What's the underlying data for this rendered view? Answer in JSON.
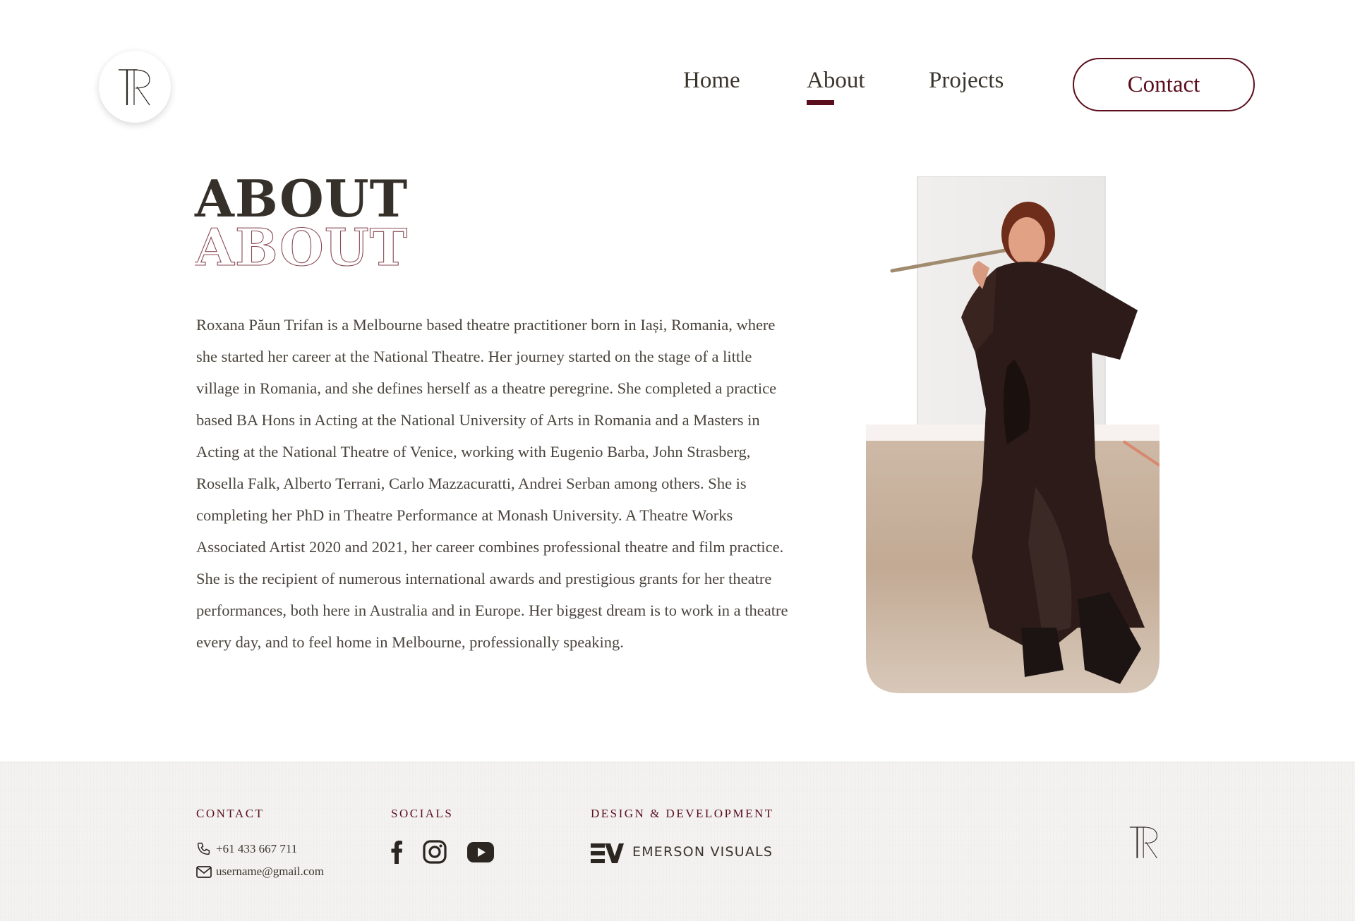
{
  "header": {
    "logo_alt": "TR monogram logo",
    "nav": [
      {
        "label": "Home"
      },
      {
        "label": "About"
      },
      {
        "label": "Projects"
      }
    ],
    "active_nav": "About",
    "contact_button": "Contact"
  },
  "main": {
    "title": "ABOUT",
    "title_outline": "ABOUT",
    "bio": "Roxana Păun Trifan is a Melbourne based theatre practitioner born in Iași, Romania, where she started her career at the National Theatre. Her journey started on the stage of a little village in Romania, and she defines herself as a theatre peregrine. She completed a practice based BA Hons in Acting at the National University of Arts in Romania and a Masters in Acting at the National Theatre of Venice, working with Eugenio Barba, John Strasberg, Rosella Falk, Alberto Terrani, Carlo Mazzacuratti, Andrei Serban among others. She is completing her PhD in Theatre Performance at Monash University. A Theatre Works Associated Artist 2020 and 2021, her career combines professional theatre and film practice. She is the recipient of numerous international awards and prestigious grants for her theatre performances, both here in Australia and in Europe. Her biggest dream is to work in a theatre every day, and to feel home in Melbourne, professionally speaking."
  },
  "footer": {
    "contact_heading": "CONTACT",
    "phone": "+61 433 667 711",
    "email": "username@gmail.com",
    "socials_heading": "SOCIALS",
    "socials": [
      "facebook-icon",
      "instagram-icon",
      "youtube-icon"
    ],
    "design_heading": "DESIGN & DEVELOPMENT",
    "design_brand": "EMERSON VISUALS"
  },
  "colors": {
    "accent": "#5b0f1d",
    "text": "#3a352c",
    "footer_bg": "#f4f3f2"
  }
}
